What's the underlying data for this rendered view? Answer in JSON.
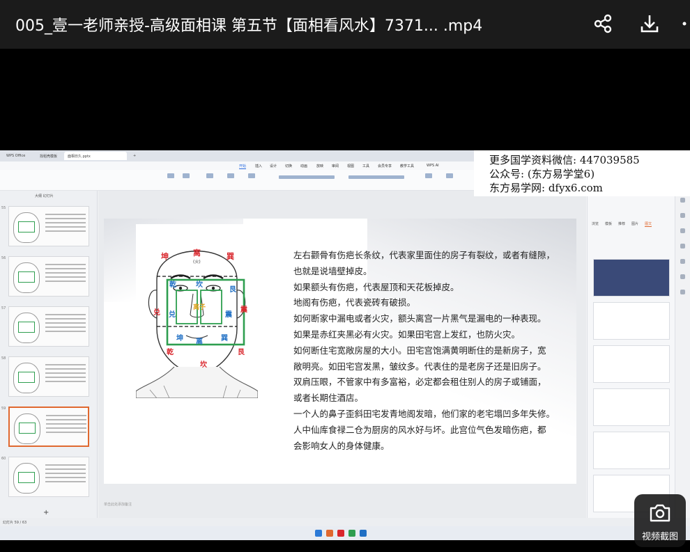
{
  "player": {
    "title": "005_壹一老师亲授-高级面相课 第五节【面相看风水】7371...  .mp4",
    "icons": [
      "share-icon",
      "download-icon",
      "more-icon"
    ],
    "snapshot_label": "视频截图"
  },
  "watermark": {
    "line1": "更多国学资料微信: 447039585",
    "line2": "公众号: (东方易学堂6)",
    "line3": "东方易学网: dfyx6.com"
  },
  "app": {
    "tabs": [
      "WPS Office",
      "找稻壳模板",
      "面相日久.pptx",
      "+"
    ],
    "menu": [
      "开始",
      "插入",
      "设计",
      "切换",
      "动画",
      "放映",
      "审阅",
      "视图",
      "工具",
      "会员专享",
      "教学工具",
      "WPS AI"
    ],
    "active_menu": "开始",
    "left_panel_title": "大纲  幻灯片",
    "slide_numbers": [
      "55",
      "56",
      "57",
      "58",
      "59",
      "60"
    ],
    "current_slide_index": 4,
    "notes_placeholder": "单击此处添加备注",
    "status_left": "幻灯片 59 / 63",
    "right_tabs": [
      "浏览",
      "模板",
      "推荐",
      "图片",
      "图文"
    ],
    "right_active_tab": "图文"
  },
  "slide": {
    "diagram_labels": {
      "kun_top": "坤",
      "li": "离",
      "huo": "(火)",
      "xun_top": "巽",
      "qian_left": "乾",
      "kan": "坎",
      "gen": "艮",
      "dui_out": "兑",
      "dui_in": "兑",
      "zhen_in": "震",
      "zhen_out": "震",
      "kun_bottom": "坤",
      "li_bottom": "离",
      "xun_bottom": "巽",
      "qian_bottom": "乾",
      "kan_bottom": "坎",
      "gen_bottom": "艮",
      "center": "离子"
    },
    "lines": [
      "左右颧骨有伤疤长条纹，代表家里面住的房子有裂纹，或者有缝隙，",
      "也就是说墙壁掉皮。",
      "如果额头有伤疤，代表屋顶和天花板掉皮。",
      "地阁有伤疤，代表瓷砖有破损。",
      "如何断家中漏电或者火灾，额头离宫一片黑气是漏电的一种表现。",
      "如果是赤红夹黑必有火灾。如果田宅宫上发红，也防火灾。",
      "如何断住宅宽敞房屋的大小。田宅宫饱满黄明断住的是新房子，宽",
      "敞明亮。如田宅宫发黑，皱纹多。代表住的是老房子还是旧房子。",
      "双肩压眼，不管家中有多富裕，必定都会租住别人的房子或铺面，",
      "或者长期住酒店。",
      "一个人的鼻子歪斜田宅发青地阁发暗，他们家的老宅塌凹多年失修。",
      "人中仙库食禄二仓为厨房的风水好与坏。此宫位气色发暗伤疤，都",
      "会影响女人的身体健康。"
    ]
  },
  "colors": {
    "topbar": "#1b1b1b",
    "label_red": "#d9262c",
    "label_blue": "#1f6fc4",
    "box_green": "#2e9e4f",
    "accent_orange": "#e0682f"
  }
}
